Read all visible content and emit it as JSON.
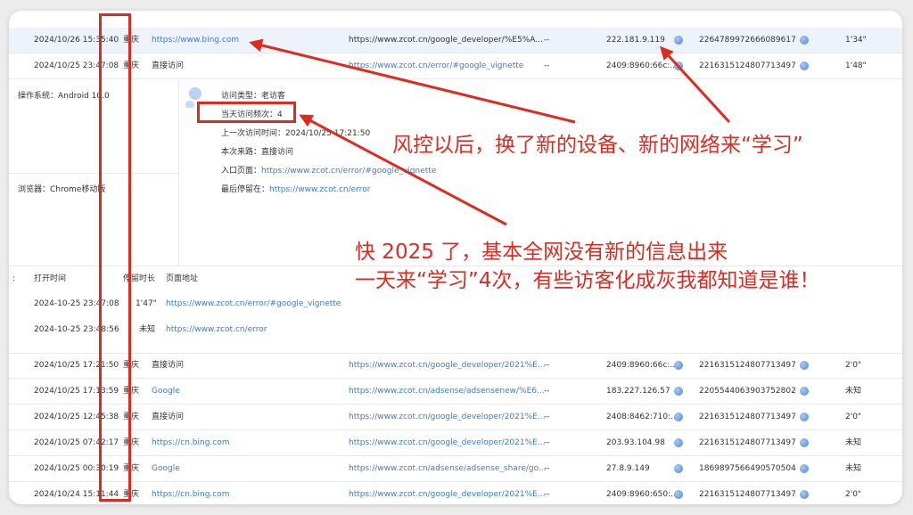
{
  "visits": [
    {
      "time": "2024/10/26 15:35:40",
      "city": "重庆",
      "source": "https://www.bing.com",
      "source_is_link": true,
      "url": "https://www.zcot.cn/google_developer/%E5%A...",
      "url_is_link": false,
      "dash": "--",
      "ip": "222.181.9.119",
      "visitor_id": "2264789972666089617",
      "duration": "1'34\""
    },
    {
      "time": "2024/10/25 23:47:08",
      "city": "重庆",
      "source": "直接访问",
      "source_is_link": false,
      "url": "https://www.zcot.cn/error/#google_vignette",
      "url_is_link": true,
      "dash": "--",
      "ip": "2409:8960:66c:...",
      "visitor_id": "2216315124807713497",
      "duration": "1'48\""
    },
    {
      "time": "2024/10/25 17:21:50",
      "city": "重庆",
      "source": "直接访问",
      "source_is_link": false,
      "url": "https://www.zcot.cn/google_developer/2021%E...",
      "url_is_link": true,
      "dash": "--",
      "ip": "2409:8960:66c:...",
      "visitor_id": "2216315124807713497",
      "duration": "2'0\""
    },
    {
      "time": "2024/10/25 17:13:59",
      "city": "重庆",
      "source": "Google",
      "source_is_link": true,
      "url": "https://www.zcot.cn/adsense/adsensenew/%E6...",
      "url_is_link": true,
      "dash": "--",
      "ip": "183.227.126.57",
      "visitor_id": "2205544063903752802",
      "duration": "未知"
    },
    {
      "time": "2024/10/25 12:45:38",
      "city": "重庆",
      "source": "直接访问",
      "source_is_link": false,
      "url": "https://www.zcot.cn/google_developer/2021%E...",
      "url_is_link": true,
      "dash": "--",
      "ip": "2408:8462:710:...",
      "visitor_id": "2216315124807713497",
      "duration": "2'0\""
    },
    {
      "time": "2024/10/25 07:42:17",
      "city": "重庆",
      "source": "https://cn.bing.com",
      "source_is_link": true,
      "url": "https://www.zcot.cn/google_developer/2021%E...",
      "url_is_link": true,
      "dash": "--",
      "ip": "203.93.104.98",
      "visitor_id": "2216315124807713497",
      "duration": "未知"
    },
    {
      "time": "2024/10/25 00:30:19",
      "city": "重庆",
      "source": "Google",
      "source_is_link": true,
      "url": "https://www.zcot.cn/adsense/adsense_share/go...",
      "url_is_link": true,
      "dash": "--",
      "ip": "27.8.9.149",
      "visitor_id": "1869897566490570504",
      "duration": "未知"
    },
    {
      "time": "2024/10/24 15:11:44",
      "city": "重庆",
      "source": "https://cn.bing.com",
      "source_is_link": true,
      "url": "https://www.zcot.cn/google_developer/2021%E...",
      "url_is_link": true,
      "dash": "--",
      "ip": "2409:8960:650:...",
      "visitor_id": "2216315124807713497",
      "duration": "2'0\""
    }
  ],
  "detail": {
    "os_label": "操作系统：",
    "os_value": "Android 10.0",
    "browser_label": "浏览器：",
    "browser_value": "Chrome移动版",
    "visit_type_label": "访问类型：",
    "visit_type_value": "老访客",
    "freq_label": "当天访问频次：",
    "freq_value": "4",
    "last_time_label": "上一次访问时间：",
    "last_time_value": "2024/10/25 17:21:50",
    "source_label": "本次来路：",
    "source_value": "直接访问",
    "entry_label": "入口页面：",
    "entry_value": "https://www.zcot.cn/error/#google_vignette",
    "exit_label": "最后停留在：",
    "exit_value": "https://www.zcot.cn/error"
  },
  "subtable": {
    "marker": ":",
    "col_open_time": "打开时间",
    "col_stay": "停留时长",
    "col_page": "页面地址",
    "rows": [
      {
        "time": "2024-10-25 23:47:08",
        "stay": "1'47\"",
        "page": "https://www.zcot.cn/error/#google_vignette"
      },
      {
        "time": "2024-10-25 23:48:56",
        "stay": "未知",
        "page": "https://www.zcot.cn/error"
      }
    ]
  },
  "annotations": {
    "caption1": "风控以后，换了新的设备、新的网络来“学习”",
    "caption2_line1": "快 2025 了，基本全网没有新的信息出来",
    "caption2_line2": "一天来“学习”4次，有些访客化成灰我都知道是谁！"
  },
  "colors": {
    "annotation_red": "#e02a1f",
    "link_blue": "#3e7bd0",
    "highlight_row": "#eef3fb"
  },
  "icons": {
    "ip_locate": "globe-icon",
    "visitor_id": "globe-icon",
    "visitor_avatar": "user-avatar-icon"
  }
}
